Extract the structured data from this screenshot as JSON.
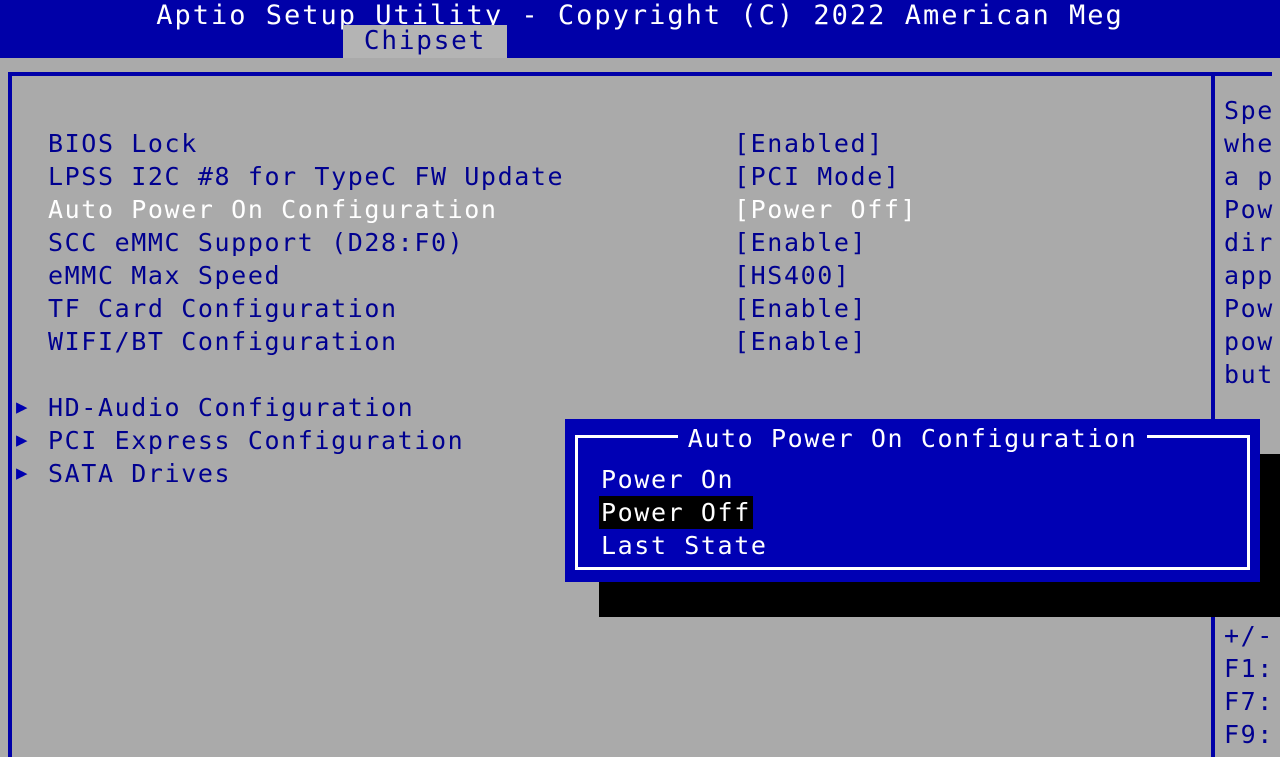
{
  "header": {
    "title": "Aptio Setup Utility - Copyright (C) 2022 American Meg",
    "tab_label": "Chipset"
  },
  "settings": {
    "rows": [
      {
        "label": "BIOS Lock",
        "value": "[Enabled]",
        "selected": false,
        "arrow": ""
      },
      {
        "label": "LPSS I2C #8 for TypeC FW Update",
        "value": "[PCI Mode]",
        "selected": false,
        "arrow": ""
      },
      {
        "label": "Auto Power On Configuration",
        "value": "[Power Off]",
        "selected": true,
        "arrow": ""
      },
      {
        "label": "SCC eMMC Support (D28:F0)",
        "value": "[Enable]",
        "selected": false,
        "arrow": ""
      },
      {
        "label": "eMMC Max Speed",
        "value": "[HS400]",
        "selected": false,
        "arrow": ""
      },
      {
        "label": "TF Card Configuration",
        "value": "[Enable]",
        "selected": false,
        "arrow": ""
      },
      {
        "label": "WIFI/BT Configuration",
        "value": "[Enable]",
        "selected": false,
        "arrow": ""
      }
    ],
    "submenus": [
      {
        "label": "HD-Audio Configuration",
        "arrow": "▶"
      },
      {
        "label": "PCI Express Configuration",
        "arrow": "▶"
      },
      {
        "label": "SATA Drives",
        "arrow": "▶"
      }
    ]
  },
  "help_panel": {
    "lines": [
      "Spe",
      "whe",
      "a p",
      "Pow",
      "dir",
      "app",
      "Pow",
      "pow",
      "but"
    ]
  },
  "keys_panel": {
    "lines": [
      "+/-",
      "F1:",
      "F7:",
      "F9:"
    ]
  },
  "popup": {
    "title": "Auto Power On Configuration",
    "options": [
      {
        "label": "Power On",
        "highlighted": false
      },
      {
        "label": "Power Off",
        "highlighted": true
      },
      {
        "label": "Last State",
        "highlighted": false
      }
    ]
  },
  "colors": {
    "header_blue": "#0000a8",
    "popup_blue": "#0000b4",
    "panel_gray": "#aaaaaa",
    "tab_gray": "#b4b4b4",
    "text_blue": "#000090",
    "text_white": "#ffffff",
    "highlight_black": "#000000"
  }
}
